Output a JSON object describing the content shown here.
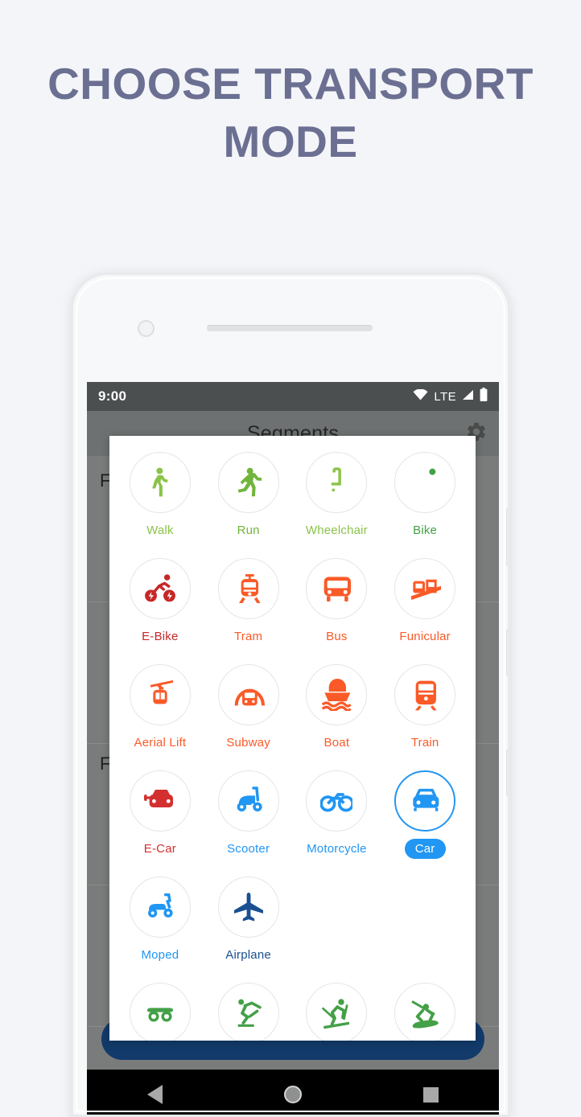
{
  "headline": "CHOOSE TRANSPORT MODE",
  "colors": {
    "headline": "#6b6f92",
    "page_bg": "#f4f5f8",
    "green_light": "#8bc34a",
    "green_dark": "#43a047",
    "orange": "#fa5a28",
    "red_dark": "#c62828",
    "red": "#d32f2f",
    "blue": "#2196f3",
    "blue_dark": "#1a4f91",
    "navy": "#123b6b",
    "selected_accent": "#2196f3"
  },
  "status_bar": {
    "time": "9:00",
    "network_label": "LTE",
    "icons": [
      "wifi-icon",
      "signal-icon",
      "battery-icon"
    ]
  },
  "app_background": {
    "title": "Segments",
    "gear_icon": "gear-icon",
    "row_labels": [
      "F",
      "F"
    ],
    "bottom_button_label": ""
  },
  "nav_bar": {
    "back": "back-icon",
    "home": "home-icon",
    "recents": "recents-icon"
  },
  "dialog": {
    "modes": [
      {
        "label": "Walk",
        "icon": "walk-icon",
        "color": "#8bc34a",
        "selected": false
      },
      {
        "label": "Run",
        "icon": "run-icon",
        "color": "#72b53c",
        "selected": false
      },
      {
        "label": "Wheelchair",
        "icon": "wheelchair-icon",
        "color": "#8bc34a",
        "selected": false
      },
      {
        "label": "Bike",
        "icon": "bike-icon",
        "color": "#43a047",
        "selected": false
      },
      {
        "label": "E-Bike",
        "icon": "ebike-icon",
        "color": "#c62828",
        "selected": false
      },
      {
        "label": "Tram",
        "icon": "tram-icon",
        "color": "#fa5a28",
        "selected": false
      },
      {
        "label": "Bus",
        "icon": "bus-icon",
        "color": "#fa5a28",
        "selected": false
      },
      {
        "label": "Funicular",
        "icon": "funicular-icon",
        "color": "#fa5a28",
        "selected": false
      },
      {
        "label": "Aerial Lift",
        "icon": "aerial-lift-icon",
        "color": "#fa5a28",
        "selected": false
      },
      {
        "label": "Subway",
        "icon": "subway-icon",
        "color": "#fa5a28",
        "selected": false
      },
      {
        "label": "Boat",
        "icon": "boat-icon",
        "color": "#fa5a28",
        "selected": false
      },
      {
        "label": "Train",
        "icon": "train-icon",
        "color": "#fa5a28",
        "selected": false
      },
      {
        "label": "E-Car",
        "icon": "ecar-icon",
        "color": "#d32f2f",
        "selected": false
      },
      {
        "label": "Scooter",
        "icon": "scooter-icon",
        "color": "#2196f3",
        "selected": false
      },
      {
        "label": "Motorcycle",
        "icon": "motorcycle-icon",
        "color": "#2196f3",
        "selected": false
      },
      {
        "label": "Car",
        "icon": "car-icon",
        "color": "#2196f3",
        "selected": true
      },
      {
        "label": "Moped",
        "icon": "moped-icon",
        "color": "#2196f3",
        "selected": false
      },
      {
        "label": "Airplane",
        "icon": "airplane-icon",
        "color": "#1a4f91",
        "selected": false
      },
      {
        "label": "",
        "icon": "",
        "color": "",
        "selected": false
      },
      {
        "label": "",
        "icon": "",
        "color": "",
        "selected": false
      },
      {
        "label": "",
        "icon": "skateboard-icon",
        "color": "#43a047",
        "selected": false
      },
      {
        "label": "",
        "icon": "ice-skate-icon",
        "color": "#43a047",
        "selected": false
      },
      {
        "label": "",
        "icon": "ski-icon",
        "color": "#43a047",
        "selected": false
      },
      {
        "label": "",
        "icon": "snowboard-icon",
        "color": "#43a047",
        "selected": false
      }
    ]
  }
}
